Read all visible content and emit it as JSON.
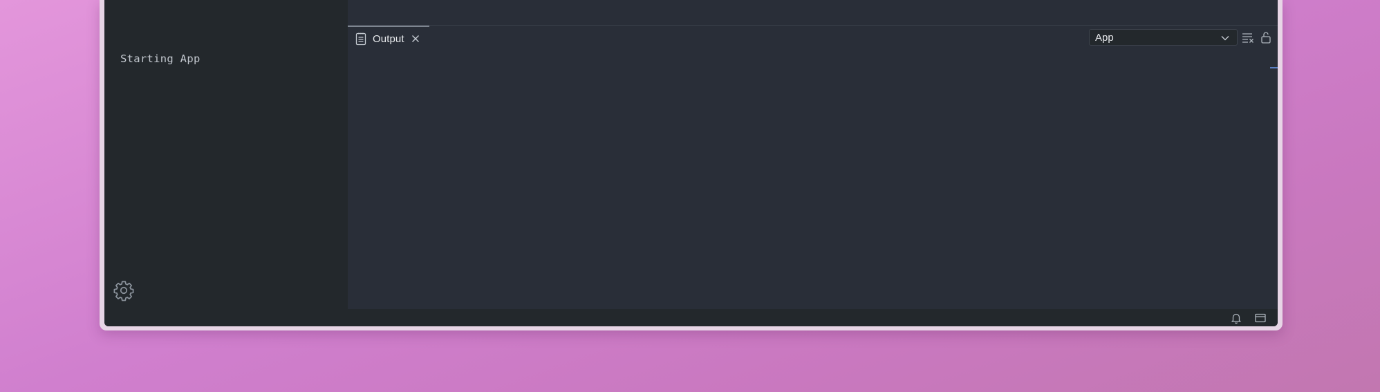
{
  "panel": {
    "tab": {
      "label": "Output",
      "icon": "output-icon"
    },
    "channel_select": {
      "value": "App",
      "icon": "chevron-down-icon"
    },
    "actions": [
      {
        "name": "clear-output",
        "icon": "clear-output-icon"
      },
      {
        "name": "lock-scroll",
        "icon": "lock-open-icon"
      }
    ],
    "output_lines": [
      "Starting App"
    ]
  },
  "sidebar": {
    "settings_icon": "gear-icon"
  },
  "status_bar": {
    "icons": [
      "bell-icon",
      "toggle-panel-icon"
    ]
  },
  "colors": {
    "background_gradient_start": "#e396db",
    "background_gradient_end": "#c277b0",
    "sidebar_bg": "#23282c",
    "panel_bg": "#292e38",
    "text": "#e8eaed",
    "scroll_marker": "#5a7fc4"
  }
}
